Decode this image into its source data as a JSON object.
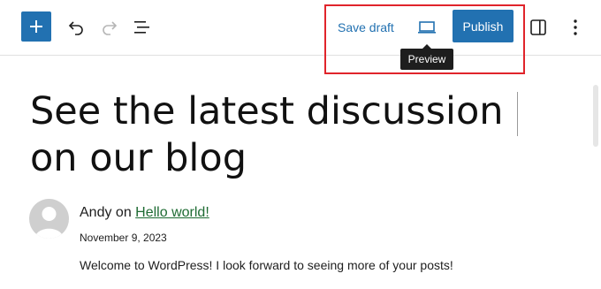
{
  "toolbar": {
    "inserter_icon": "plus-icon",
    "undo_icon": "undo-icon",
    "redo_icon": "redo-icon",
    "list_view_icon": "list-view-icon",
    "save_draft_label": "Save draft",
    "preview_icon": "laptop-icon",
    "preview_tooltip": "Preview",
    "publish_label": "Publish",
    "settings_icon": "sidebar-icon",
    "options_icon": "more-vertical-icon",
    "accent_color": "#2271b1",
    "highlight_color": "#e0242b"
  },
  "post": {
    "title": "See the latest discussion on our blog"
  },
  "comment": {
    "author": "Andy",
    "on_text": "on",
    "post_link": "Hello world!",
    "date": "November 9, 2023",
    "text": "Welcome to WordPress! I look forward to seeing more of your posts!"
  }
}
